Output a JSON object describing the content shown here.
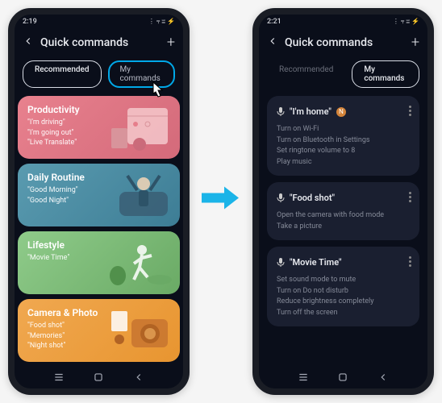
{
  "left": {
    "status": {
      "time": "2:19",
      "meta": "⚡⚙",
      "icons": "⋮ ⫧ ⩸ ⚡"
    },
    "header": {
      "title": "Quick commands"
    },
    "tabs": {
      "recommended": "Recommended",
      "mycommands": "My commands"
    },
    "cards": {
      "productivity": {
        "title": "Productivity",
        "items": [
          "\"I'm driving\"",
          "\"I'm going out\"",
          "\"Live Translate\""
        ]
      },
      "routine": {
        "title": "Daily Routine",
        "items": [
          "\"Good Morning\"",
          "\"Good Night\""
        ]
      },
      "lifestyle": {
        "title": "Lifestyle",
        "items": [
          "\"Movie Time\""
        ]
      },
      "camera": {
        "title": "Camera & Photo",
        "items": [
          "\"Food shot\"",
          "\"Memories\"",
          "\"Night shot\""
        ]
      }
    }
  },
  "right": {
    "status": {
      "time": "2:21",
      "meta": "⚡⚙",
      "icons": "⋮ ⫧ ⩸ ⚡"
    },
    "header": {
      "title": "Quick commands"
    },
    "tabs": {
      "recommended": "Recommended",
      "mycommands": "My commands"
    },
    "commands": {
      "home": {
        "title": "\"I'm home\"",
        "badge": "N",
        "actions": [
          "Turn on Wi-Fi",
          "Turn on Bluetooth in Settings",
          "Set ringtone volume to 8",
          "Play music"
        ]
      },
      "food": {
        "title": "\"Food shot\"",
        "actions": [
          "Open the camera with food mode",
          "Take a picture"
        ]
      },
      "movie": {
        "title": "\"Movie Time\"",
        "actions": [
          "Set sound mode to mute",
          "Turn on Do not disturb",
          "Reduce brightness completely",
          "Turn off the screen"
        ]
      }
    }
  }
}
